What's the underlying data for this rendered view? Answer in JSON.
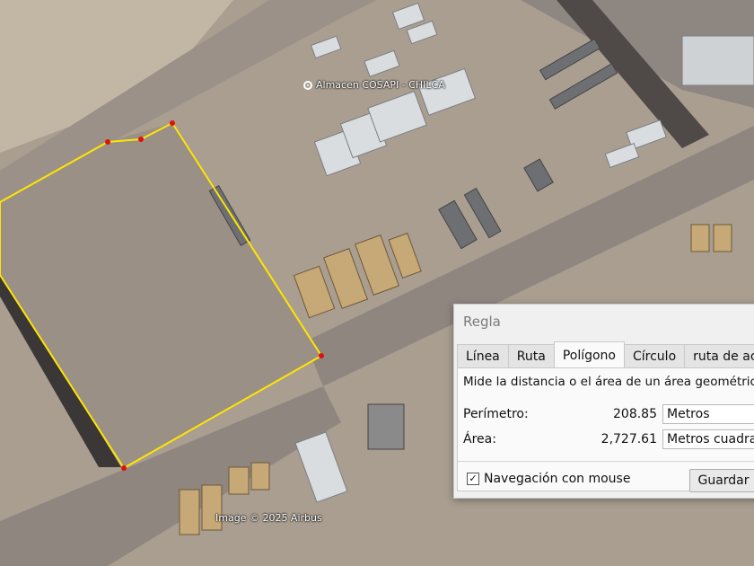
{
  "map": {
    "placemark_label": "Almacen COSAPI - CHILCA",
    "imagery_credit": "Image © 2025 Airbus",
    "measure_line_color": "#ffe600",
    "vertex_color": "#e01010"
  },
  "ruler": {
    "title": "Regla",
    "tabs": [
      {
        "label": "Línea",
        "active": false
      },
      {
        "label": "Ruta",
        "active": false
      },
      {
        "label": "Polígono",
        "active": true
      },
      {
        "label": "Círculo",
        "active": false
      },
      {
        "label": "ruta de ac",
        "active": false
      }
    ],
    "description": "Mide la distancia o el área de un área geométrica e",
    "perimeter": {
      "label": "Perímetro:",
      "value": "208.85",
      "unit": "Metros"
    },
    "area": {
      "label": "Área:",
      "value": "2,727.61",
      "unit": "Metros cuadrado"
    },
    "mouse_nav": {
      "label": "Navegación con mouse",
      "checked": true
    },
    "save_label": "Guardar"
  }
}
